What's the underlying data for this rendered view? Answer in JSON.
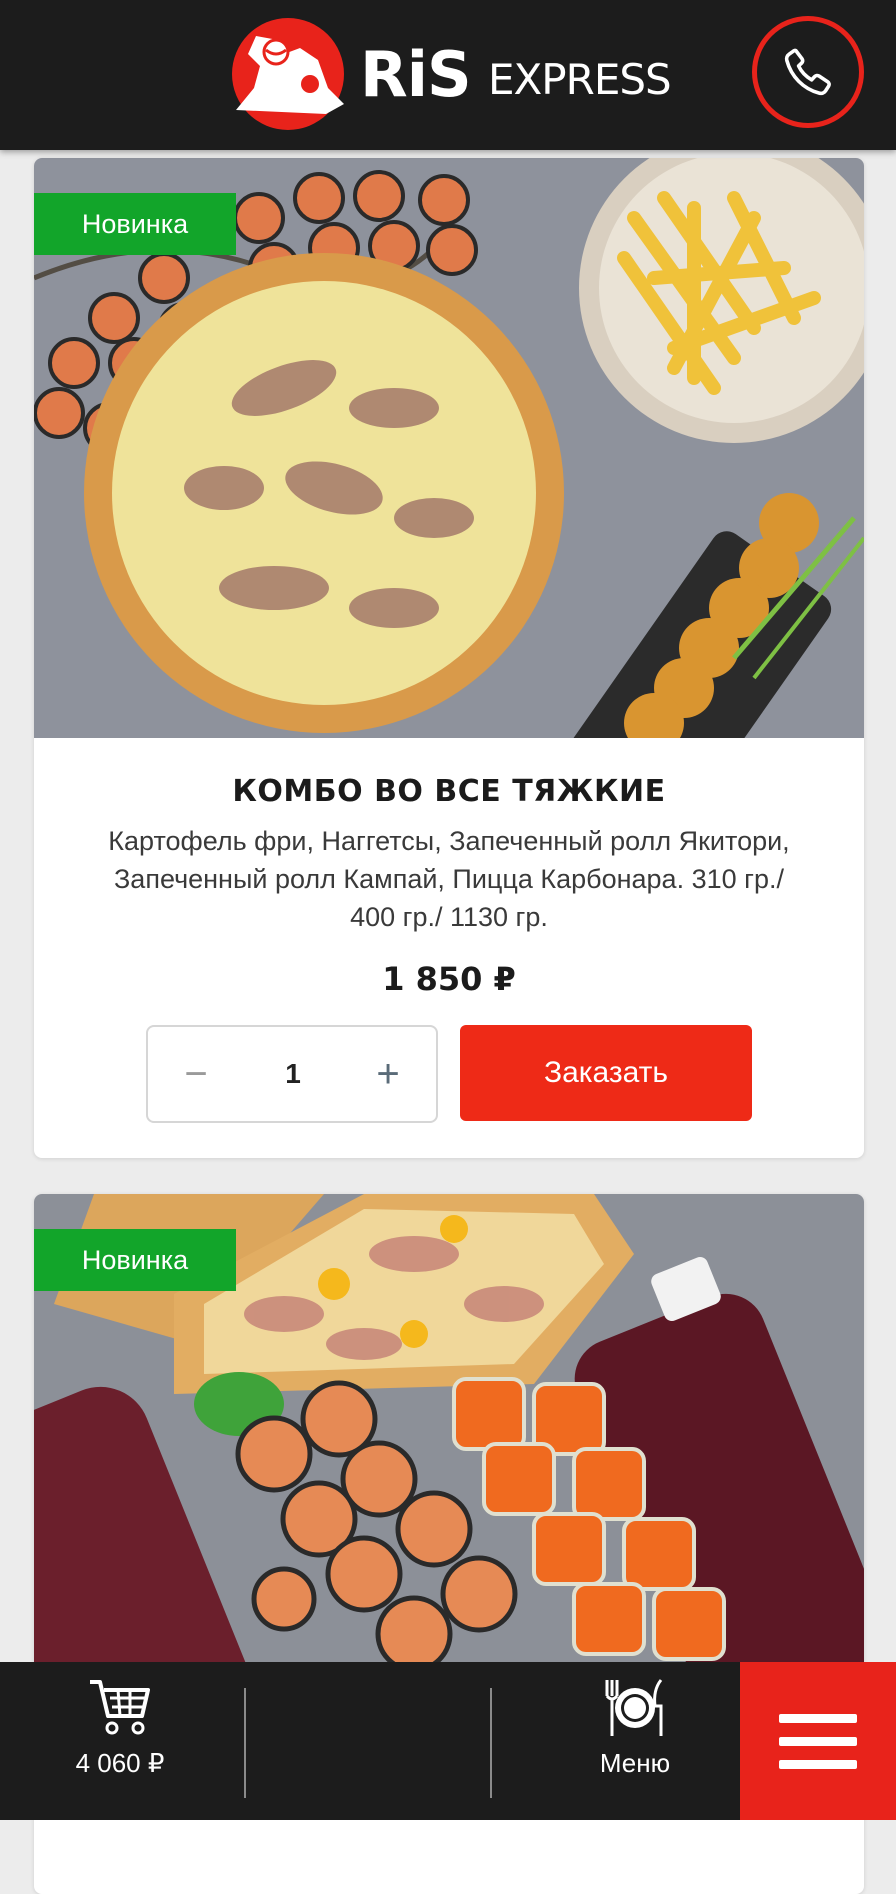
{
  "header": {
    "logo": {
      "brand": "RiS",
      "sub": "EXPRESS"
    },
    "icons": {
      "call": "phone-icon"
    },
    "colors": {
      "accent": "#e8231b",
      "bar": "#1c1c1c"
    }
  },
  "products": [
    {
      "badge": "Новинка",
      "title": "КОМБО ВО ВСЕ ТЯЖКИЕ",
      "description": "Картофель фри, Наггетсы, Запеченный ролл Якитори, Запеченный ролл Кампай, Пицца Карбонара. 310 гр./ 400 гр./ 1130 гр.",
      "price": "1 850 ₽",
      "quantity": "1",
      "minus": "−",
      "plus": "+",
      "order_label": "Заказать",
      "image": "combo-food-photo"
    },
    {
      "badge": "Новинка",
      "image": "combo-pizza-rolls-drinks-photo"
    }
  ],
  "bottom_bar": {
    "cart_total": "4 060 ₽",
    "menu_label": "Меню",
    "icons": {
      "cart": "cart-icon",
      "menu": "plate-cutlery-icon",
      "burger": "hamburger-icon"
    }
  },
  "colors": {
    "badge": "#12a52a",
    "order_button": "#ee2a17"
  }
}
